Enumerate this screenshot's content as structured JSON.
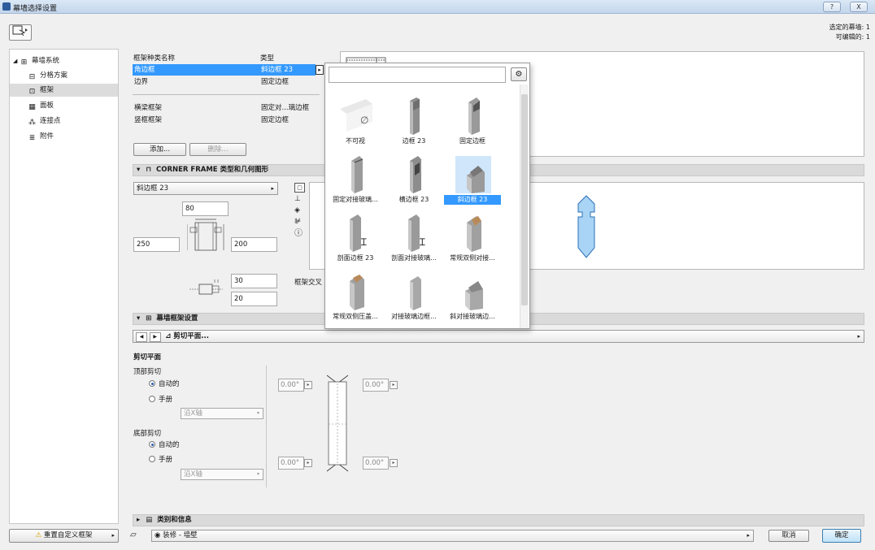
{
  "window": {
    "title": "幕墙选择设置",
    "help": "?",
    "close": "X"
  },
  "selection_info": {
    "selected": "选定的幕墙: 1",
    "editable": "可编辑的: 1"
  },
  "tree": {
    "root": "幕墙系统",
    "items": [
      {
        "label": "分格方案",
        "icon": "grid-scheme-icon"
      },
      {
        "label": "框架",
        "icon": "frame-icon"
      },
      {
        "label": "面板",
        "icon": "panel-icon"
      },
      {
        "label": "连接点",
        "icon": "junction-icon"
      },
      {
        "label": "附件",
        "icon": "accessory-icon"
      }
    ]
  },
  "reset_button": "重置自定义框架",
  "frame_list": {
    "headers": [
      "框架种类名称",
      "类型"
    ],
    "rows": [
      {
        "name": "角边框",
        "type": "斜边框 23",
        "selected": true
      },
      {
        "name": "边界",
        "type": "固定边框"
      },
      {
        "name": "横梁框架",
        "type": "固定对...璃边框"
      },
      {
        "name": "竖框框架",
        "type": "固定边框"
      }
    ],
    "add": "添加...",
    "delete": "删除..."
  },
  "popup": {
    "search_value": "",
    "items": [
      {
        "label": "不可视",
        "selected": false
      },
      {
        "label": "边框 23",
        "selected": false
      },
      {
        "label": "固定边框",
        "selected": false
      },
      {
        "label": "固定对接玻璃...",
        "selected": false
      },
      {
        "label": "横边框 23",
        "selected": false
      },
      {
        "label": "斜边框 23",
        "selected": true
      },
      {
        "label": "剖面边框 23",
        "selected": false
      },
      {
        "label": "剖面对接玻璃...",
        "selected": false
      },
      {
        "label": "常规双侧对接...",
        "selected": false
      },
      {
        "label": "常规双侧压盖...",
        "selected": false
      },
      {
        "label": "对接玻璃边框...",
        "selected": false
      },
      {
        "label": "斜对接玻璃边...",
        "selected": false
      }
    ]
  },
  "corner_section": {
    "title": "CORNER FRAME 类型和几何图形",
    "type_value": "斜边框 23",
    "height": "80",
    "left_width": "250",
    "right_width": "200",
    "depth_a": "30",
    "depth_b": "20",
    "frame_intersection": "框架交叉"
  },
  "cw_frame_section": {
    "title": "幕墙框架设置",
    "nav_label": "剪切平面..."
  },
  "cut_plane": {
    "title": "剪切平面",
    "top": {
      "label": "顶部剪切",
      "auto": "自动的",
      "manual": "手册",
      "axis": "沿X轴"
    },
    "bottom": {
      "label": "底部剪切",
      "auto": "自动的",
      "manual": "手册",
      "axis": "沿X轴"
    },
    "angles": {
      "top_left": "0.00°",
      "top_right": "0.00°",
      "bottom_left": "0.00°",
      "bottom_right": "0.00°"
    }
  },
  "category_section": {
    "title": "类别和信息"
  },
  "bottom": {
    "layer": "装修 - 墙壁",
    "cancel": "取消",
    "ok": "确定"
  }
}
